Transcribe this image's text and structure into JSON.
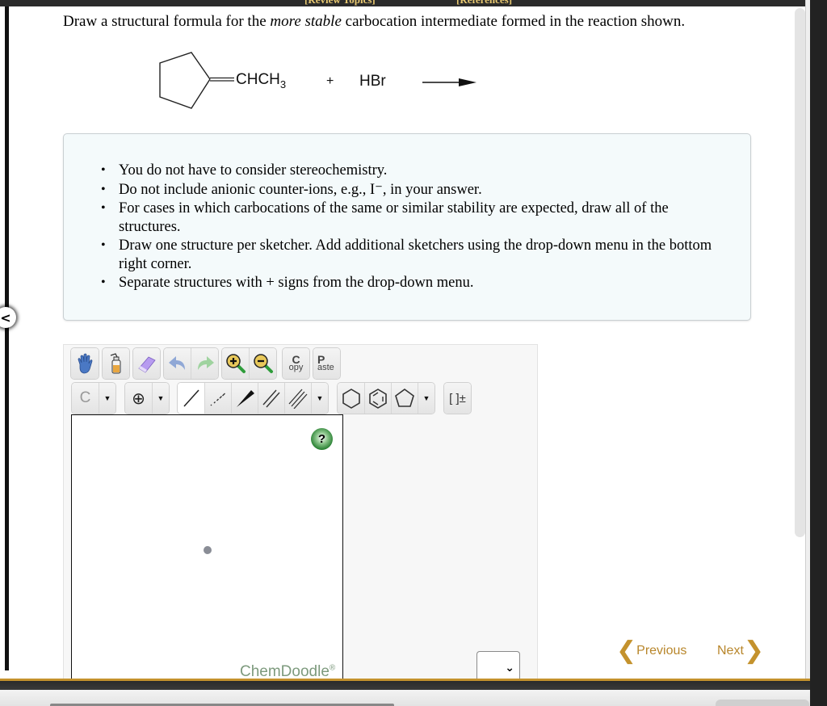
{
  "header": {
    "review_topics": "[Review Topics]",
    "references": "[References]"
  },
  "question": {
    "prefix": "Draw a structural formula for the ",
    "emphasis": "more stable",
    "suffix": " carbocation intermediate formed in the reaction shown."
  },
  "reaction": {
    "reactant1_substituent": "CHCH",
    "reactant1_subscript": "3",
    "plus": "+",
    "reactant2": "HBr"
  },
  "instructions": [
    "You do not have to consider stereochemistry.",
    "Do not include anionic counter-ions, e.g., I⁻, in your answer.",
    "For cases in which carbocations of the same or similar stability are expected, draw all of the structures.",
    "Draw one structure per sketcher. Add additional sketchers using the drop-down menu in the bottom right corner.",
    "Separate structures with + signs from the drop-down menu."
  ],
  "sketcher": {
    "toolbar_row1": [
      {
        "name": "hand-tool",
        "icon": "hand-icon"
      },
      {
        "name": "clear-tool",
        "icon": "wash-bottle-icon"
      },
      {
        "name": "eraser-tool",
        "icon": "eraser-icon"
      },
      {
        "name": "undo",
        "icon": "undo-icon"
      },
      {
        "name": "redo",
        "icon": "redo-icon"
      },
      {
        "name": "zoom-in",
        "icon": "zoom-in-icon"
      },
      {
        "name": "zoom-out",
        "icon": "zoom-out-icon"
      }
    ],
    "copy_big": "C",
    "copy_small": "opy",
    "paste_big": "P",
    "paste_small": "aste",
    "atom_label": "C",
    "charge_label": "⊕",
    "bracket_label": "[ ]±",
    "help_label": "?",
    "brand": "ChemDoodle",
    "brand_mark": "®",
    "add_select_value": ""
  },
  "navigation": {
    "previous": "Previous",
    "next": "Next"
  },
  "colors": {
    "accent_gold": "#c4922d",
    "info_bg": "#f4fafb",
    "help_green": "#1f7a2a"
  }
}
